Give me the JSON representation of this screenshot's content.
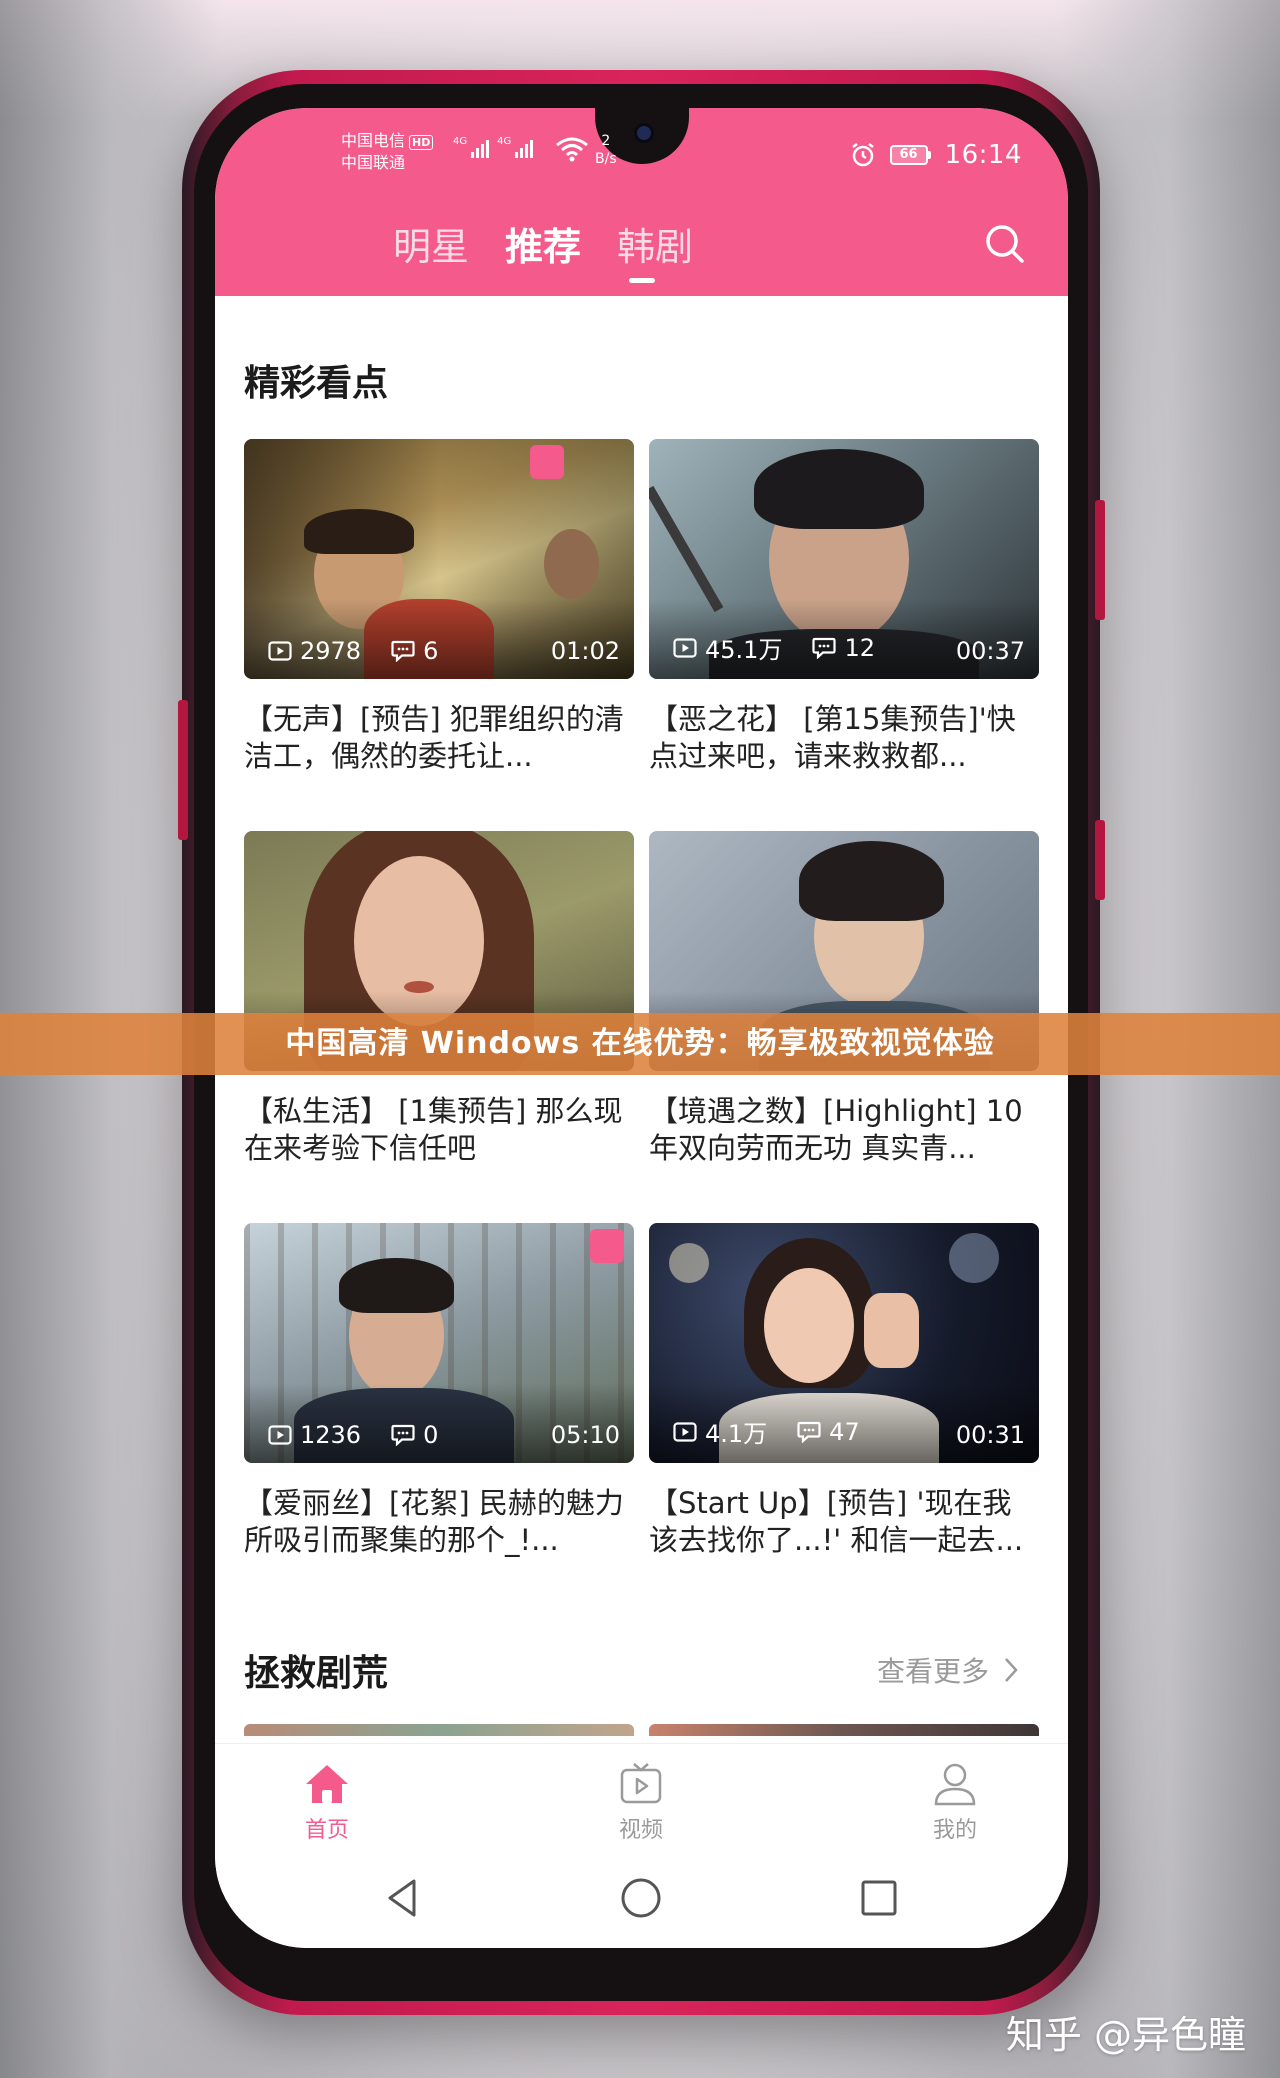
{
  "status_bar": {
    "carrier_1": "中国电信",
    "carrier_hd": "HD",
    "carrier_2": "中国联通",
    "signal_1_label": "4G",
    "signal_2_label": "4G",
    "net_speed_value": "2",
    "net_speed_unit": "B/s",
    "battery": "66",
    "time": "16:14"
  },
  "header": {
    "tabs": [
      {
        "label": "明星",
        "active": false
      },
      {
        "label": "推荐",
        "active": true
      },
      {
        "label": "韩剧",
        "active": false
      }
    ],
    "search_icon": "search-icon",
    "accent_color": "#f45a8c"
  },
  "section_highlights": {
    "title": "精彩看点",
    "cards": [
      {
        "plays": "2978",
        "comments": "6",
        "duration": "01:02",
        "title": "【无声】[预告] 犯罪组织的清洁工，偶然的委托让..."
      },
      {
        "plays": "45.1万",
        "comments": "12",
        "duration": "00:37",
        "title": "【恶之花】 [第15集预告]'快点过来吧，请来救救都..."
      },
      {
        "plays": "",
        "comments": "",
        "duration": "",
        "title": "【私生活】 [1集预告] 那么现在来考验下信任吧"
      },
      {
        "plays": "",
        "comments": "",
        "duration": "",
        "title": "【境遇之数】[Highlight] 10年双向劳而无功 真实青..."
      },
      {
        "plays": "1236",
        "comments": "0",
        "duration": "05:10",
        "title": "【爱丽丝】[花絮] 民赫的魅力所吸引而聚集的那个_!..."
      },
      {
        "plays": "4.1万",
        "comments": "47",
        "duration": "00:31",
        "title": "【Start Up】[预告] '现在我该去找你了...!' 和信一起去..."
      }
    ]
  },
  "section_rescue": {
    "title": "拯救剧荒",
    "more_label": "查看更多"
  },
  "bottom_nav": [
    {
      "label": "首页",
      "icon": "home-icon",
      "active": true
    },
    {
      "label": "视频",
      "icon": "tv-play-icon",
      "active": false
    },
    {
      "label": "我的",
      "icon": "user-icon",
      "active": false
    }
  ],
  "system_nav": [
    "back-icon",
    "home-circle-icon",
    "recents-icon"
  ],
  "overlay_banner": "中国高清 Windows 在线优势：畅享极致视觉体验",
  "watermark": "知乎 @异色瞳"
}
